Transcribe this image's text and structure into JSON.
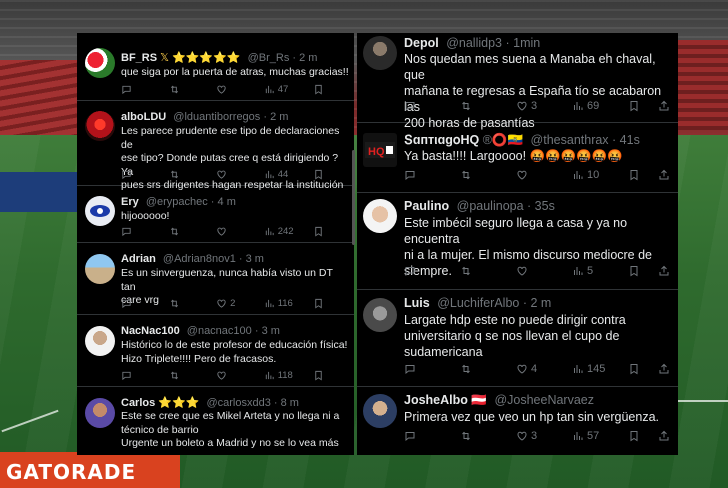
{
  "left_tweets": [
    {
      "name": "BF_RS",
      "name_suffix": "𝕏 ⭐⭐⭐⭐⭐",
      "handle": "@Br_Rs",
      "time": "· 2 m",
      "text_lines": [
        "que siga por la puerta de atras, muchas gracias!!"
      ],
      "views": "47",
      "replies": "",
      "retweets": "",
      "likes": ""
    },
    {
      "name": "alboLDU",
      "name_suffix": "",
      "handle": "@lduantiborregos",
      "time": "· 2 m",
      "text_lines": [
        "Les parece prudente ese tipo de declaraciones de",
        "ese tipo? Donde putas cree q está dirigiendo ? Ya",
        "pues srs dirigentes hagan respetar la institución"
      ],
      "views": "44",
      "replies": "",
      "retweets": "",
      "likes": ""
    },
    {
      "name": "Ery",
      "name_suffix": "",
      "handle": "@erypachec",
      "time": "· 4 m",
      "text_lines": [
        "hijoooooo!"
      ],
      "views": "242",
      "replies": "",
      "retweets": "",
      "likes": ""
    },
    {
      "name": "Adrian",
      "name_suffix": "",
      "handle": "@Adrian8nov1",
      "time": "· 3 m",
      "text_lines": [
        "Es un sinverguenza, nunca había visto un DT tan",
        "care vrg"
      ],
      "views": "116",
      "replies": "",
      "retweets": "",
      "likes": "2"
    },
    {
      "name": "NacNac100",
      "name_suffix": "",
      "handle": "@nacnac100",
      "time": "· 3 m",
      "text_lines": [
        "Histórico lo de este profesor de educación física!",
        "Hizo Triplete!!!! Pero de fracasos."
      ],
      "views": "118",
      "replies": "",
      "retweets": "",
      "likes": ""
    },
    {
      "name": "Carlos",
      "name_suffix": "⭐⭐⭐",
      "handle": "@carlosxdd3",
      "time": "· 8 m",
      "text_lines": [
        "Este se cree que es Mikel Arteta y no llega ni a",
        "técnico de barrio",
        "Urgente un boleto a Madrid y no se lo vea más"
      ],
      "views": "",
      "replies": "",
      "retweets": "",
      "likes": ""
    }
  ],
  "right_tweets": [
    {
      "name": "Depol",
      "name_suffix": "",
      "handle": "@nallidp3",
      "time": "· 1min",
      "text_lines": [
        "Nos quedan mes suena a Manaba eh chaval, que",
        "mañana te regresas a España tío se acabaron las",
        "200 horas de pasantías"
      ],
      "views": "69",
      "replies": "",
      "retweets": "",
      "likes": "3"
    },
    {
      "name": "ՏɑптιɑɡօHQ",
      "name_suffix": "®⭕🇪🇨",
      "handle": "@thesanthrax",
      "time": "· 41s",
      "text_lines": [
        "Ya basta!!!! Largoooo! 🤬🤬🤬🤬🤬🤬"
      ],
      "views": "10",
      "replies": "",
      "retweets": "",
      "likes": ""
    },
    {
      "name": "Paulino",
      "name_suffix": "",
      "handle": "@paulinopa",
      "time": "· 35s",
      "text_lines": [
        "Este imbécil seguro llega a casa y ya no encuentra",
        "ni a la mujer. El mismo discurso mediocre de",
        "siempre."
      ],
      "views": "5",
      "replies": "",
      "retweets": "",
      "likes": ""
    },
    {
      "name": "Luis",
      "name_suffix": "",
      "handle": "@LuchiferAlbo",
      "time": "· 2 m",
      "text_lines": [
        "Largate hdp este no puede dirigir contra",
        "universitario q se nos llevan el cupo de",
        "sudamericana"
      ],
      "views": "145",
      "replies": "",
      "retweets": "",
      "likes": "4"
    },
    {
      "name": "JosheAlbo",
      "name_suffix": "🇦🇹",
      "handle": "@JosheeNarvaez",
      "time": "· 2 m",
      "text_lines": [
        "Primera vez que veo un hp tan sin vergüenza."
      ],
      "views": "57",
      "replies": "",
      "retweets": "",
      "likes": "3"
    }
  ],
  "background": {
    "sponsor": "GATORADE"
  },
  "colors": {
    "panel_bg": "#000000",
    "text": "#e7e9ea",
    "muted": "#71767b",
    "divider": "#2f3336"
  },
  "icons": [
    "reply-icon",
    "retweet-icon",
    "like-icon",
    "views-icon",
    "bookmark-icon",
    "share-icon"
  ]
}
